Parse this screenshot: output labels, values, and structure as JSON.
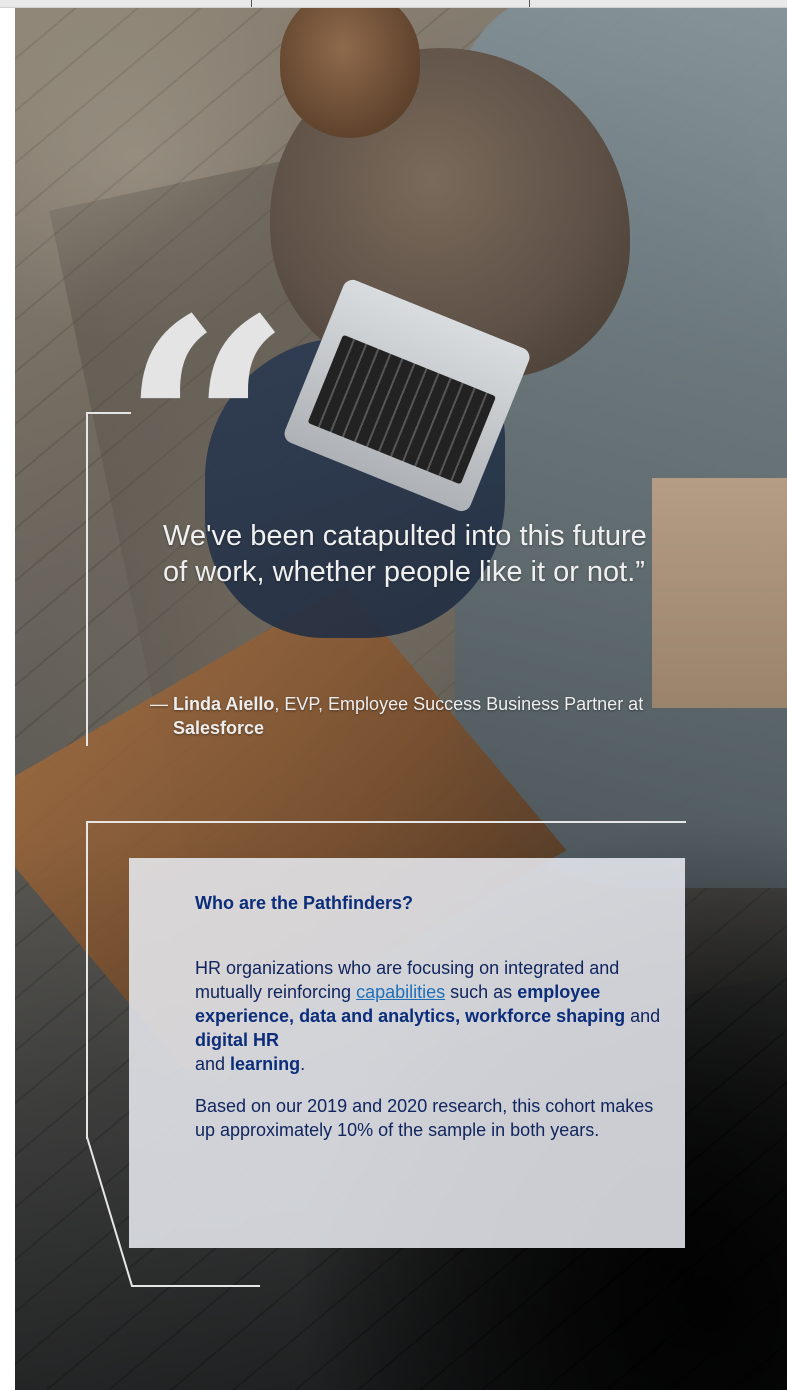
{
  "quote": {
    "text": "We've been catapulted into this future of work, whether people like it or not.”",
    "dash": "—",
    "author_name": "Linda Aiello",
    "author_role": ", EVP, Employee Success Business Partner at ",
    "company": "Salesforce"
  },
  "panel": {
    "title": "Who are the Pathfinders?",
    "p1": {
      "prefix": "HR organizations who are focusing on integrated and mutually reinforcing ",
      "link": "capabilities",
      "mid1": " such as ",
      "bold1": "employee experience, data and analytics, workforce shaping",
      "mid2": " and ",
      "bold2": "digital HR",
      "mid3": " and ",
      "bold3": "learning",
      "end": "."
    },
    "p2": "Based on our 2019 and 2020 research, this cohort makes up approximately 10% of the sample in both years."
  },
  "colors": {
    "panel_title": "#0b2d7a",
    "panel_text": "#10245e",
    "link": "#1f6fb8",
    "line": "#e6e6e6"
  },
  "icons": [
    "quote-icon"
  ]
}
